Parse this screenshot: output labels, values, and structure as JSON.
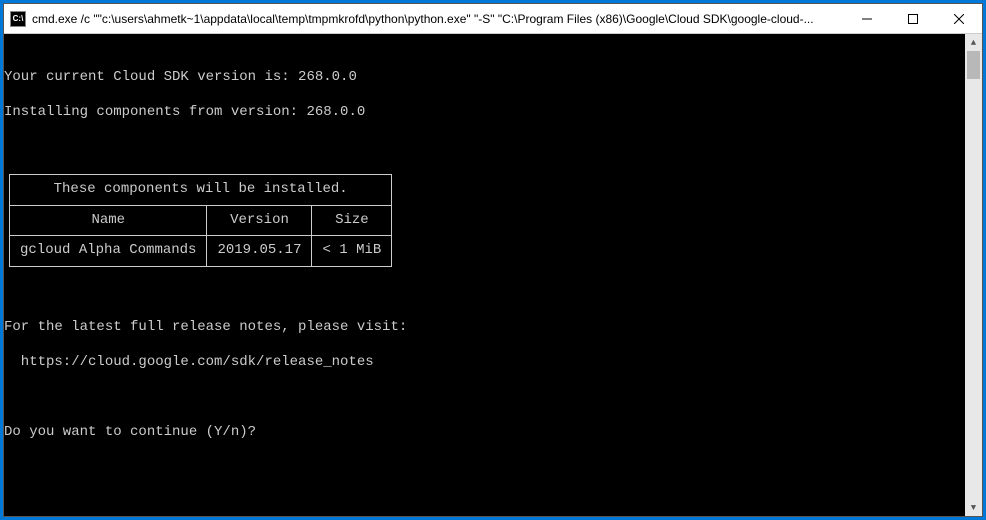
{
  "titlebar": {
    "icon_text": "C:\\",
    "text": "cmd.exe  /c \"\"c:\\users\\ahmetk~1\\appdata\\local\\temp\\tmpmkrofd\\python\\python.exe\" \"-S\" \"C:\\Program Files (x86)\\Google\\Cloud SDK\\google-cloud-..."
  },
  "terminal": {
    "blank_top": " ",
    "line1": "Your current Cloud SDK version is: 268.0.0",
    "line2": "Installing components from version: 268.0.0",
    "blank_mid1": " ",
    "table": {
      "caption": "These components will be installed.",
      "headers": [
        "Name",
        "Version",
        "Size"
      ],
      "rows": [
        [
          "gcloud Alpha Commands",
          "2019.05.17",
          "< 1 MiB"
        ]
      ]
    },
    "blank_mid2": " ",
    "line3": "For the latest full release notes, please visit:",
    "line4": "  https://cloud.google.com/sdk/release_notes",
    "blank_mid3": " ",
    "prompt": "Do you want to continue (Y/n)? "
  }
}
